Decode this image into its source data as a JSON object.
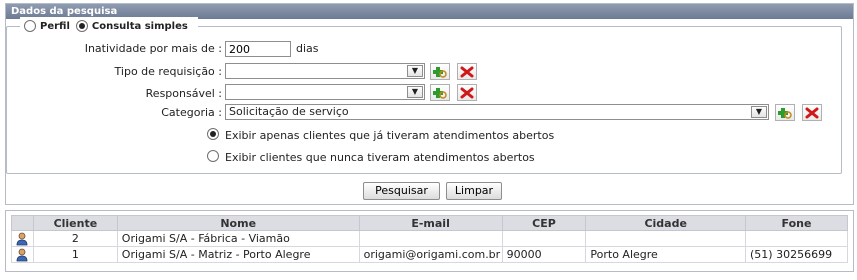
{
  "panel": {
    "title": "Dados da pesquisa"
  },
  "mode": {
    "options": [
      {
        "label": "Perfil",
        "checked": false
      },
      {
        "label": "Consulta simples",
        "checked": true
      }
    ]
  },
  "form": {
    "inatividade": {
      "label": "Inatividade por mais de :",
      "value": "200",
      "suffix": "dias"
    },
    "tipo_requisicao": {
      "label": "Tipo de requisição :",
      "value": ""
    },
    "responsavel": {
      "label": "Responsável :",
      "value": ""
    },
    "categoria": {
      "label": "Categoria :",
      "value": "Solicitação de serviço"
    },
    "exibir": [
      {
        "label": "Exibir apenas clientes que já tiveram atendimentos abertos",
        "checked": true
      },
      {
        "label": "Exibir clientes que nunca tiveram atendimentos abertos",
        "checked": false
      }
    ]
  },
  "actions": {
    "search": "Pesquisar",
    "clear": "Limpar"
  },
  "table": {
    "columns": [
      "Cliente",
      "Nome",
      "E-mail",
      "CEP",
      "Cidade",
      "Fone"
    ],
    "rows": [
      {
        "icon": "user-icon",
        "cliente": "2",
        "nome": "Origami S/A - Fábrica - Viamão",
        "email": "",
        "cep": "",
        "cidade": "",
        "fone": ""
      },
      {
        "icon": "user-icon",
        "cliente": "1",
        "nome": "Origami S/A - Matriz - Porto Alegre",
        "email": "origami@origami.com.br",
        "cep": "90000",
        "cidade": "Porto Alegre",
        "fone": "(51) 30256699"
      }
    ]
  },
  "colors": {
    "header": "#7b879d",
    "add_icon": "#2e9b2e",
    "remove_icon": "#d01818"
  }
}
